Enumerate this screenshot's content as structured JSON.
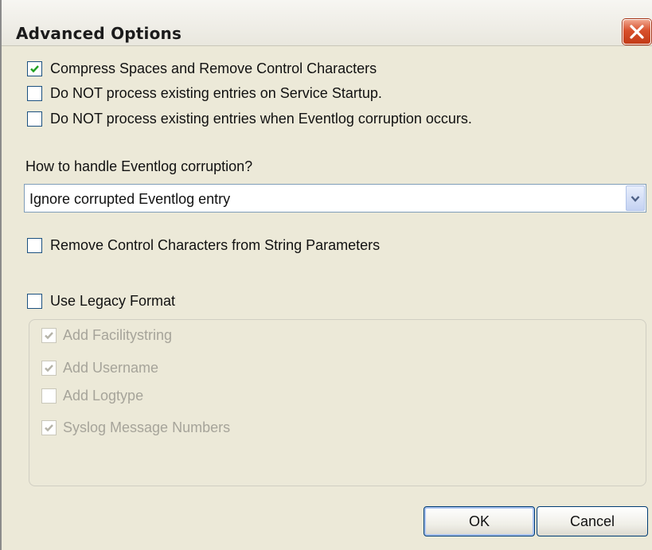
{
  "dialog": {
    "title": "Advanced Options",
    "close_icon": "close-x-icon"
  },
  "options": [
    {
      "label": "Compress Spaces and Remove Control Characters",
      "checked": true
    },
    {
      "label": "Do NOT process existing entries on Service Startup.",
      "checked": false
    },
    {
      "label": "Do NOT process existing entries when Eventlog corruption occurs.",
      "checked": false
    }
  ],
  "corruption": {
    "label": "How to handle Eventlog corruption?",
    "selected": "Ignore corrupted Eventlog entry"
  },
  "remove_control_chars": {
    "label": "Remove Control Characters from String Parameters",
    "checked": false
  },
  "legacy": {
    "label": "Use Legacy Format",
    "checked": false,
    "items": [
      {
        "label": "Add Facilitystring",
        "checked": true,
        "enabled": false
      },
      {
        "label": "Add Username",
        "checked": true,
        "enabled": false
      },
      {
        "label": "Add Logtype",
        "checked": false,
        "enabled": false
      },
      {
        "label": "Syslog Message Numbers",
        "checked": true,
        "enabled": false
      }
    ]
  },
  "buttons": {
    "ok": "OK",
    "cancel": "Cancel"
  },
  "colors": {
    "check_enabled": "#21a121",
    "check_disabled": "#b5b3a8",
    "close_red": "#d8502c"
  }
}
